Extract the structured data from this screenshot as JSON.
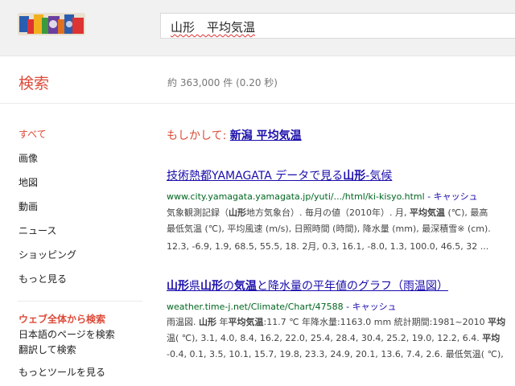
{
  "header": {
    "query": "山形　平均気温"
  },
  "subheader": {
    "label": "検索",
    "stats": "約 363,000 件 (0.20 秒)"
  },
  "nav": {
    "items": [
      "すべて",
      "画像",
      "地図",
      "動画",
      "ニュース",
      "ショッピング",
      "もっと見る"
    ],
    "web_header": "ウェブ全体から検索",
    "links": [
      "日本語のページを検索",
      "翻訳して検索"
    ],
    "more_tools": "もっとツールを見る"
  },
  "did_you_mean": {
    "prefix": "もしかして: ",
    "suggestion": "新潟 平均気温"
  },
  "results": [
    {
      "title_a": "技術熱都YAMAGATA データで見る",
      "title_b": "山形",
      "title_c": "-気候",
      "url": "www.city.yamagata.yamagata.jp/yuti/.../html/ki-kisyo.html",
      "cache": " - キャッシュ",
      "line1a": "気象観測記録（",
      "line1b": "山形",
      "line1c": "地方気象台）. 毎月の値（2010年）. 月, ",
      "line1d": "平均気温",
      "line1e": " (℃), 最高",
      "line2": "最低気温 (℃), 平均風速 (m/s), 日照時間 (時間), 降水量 (mm), 最深積雪※ (cm).",
      "line3": "12.3, -6.9, 1.9, 68.5, 55.5, 18. 2月, 0.3, 16.1, -8.0, 1.3, 100.0, 46.5, 32 ..."
    },
    {
      "title_a": "山形",
      "title_b": "県",
      "title_c": "山形",
      "title_d": "の",
      "title_e": "気温",
      "title_f": "と降水量の平年値のグラフ（雨温図）",
      "url": "weather.time-j.net/Climate/Chart/47588",
      "cache": " - キャッシュ",
      "line1a": "雨温図. ",
      "line1b": "山形",
      "line1c": " 年",
      "line1d": "平均気温",
      "line1e": ":11.7 ℃ 年降水量:1163.0 mm 統計期間:1981~2010 ",
      "line1f": "平均",
      "line2a": "温( ℃), 3.1, 4.0, 8.4, 16.2, 22.0, 25.4, 28.4, 30.4, 25.2, 19.0, 12.2, 6.4. ",
      "line2b": "平均",
      "line3": "-0.4, 0.1, 3.5, 10.1, 15.7, 19.8, 23.3, 24.9, 20.1, 13.6, 7.4, 2.6. 最低気温( ℃),"
    }
  ],
  "colors": {
    "accent": "#dd4b39",
    "link": "#1a0dab",
    "url": "#006621"
  }
}
